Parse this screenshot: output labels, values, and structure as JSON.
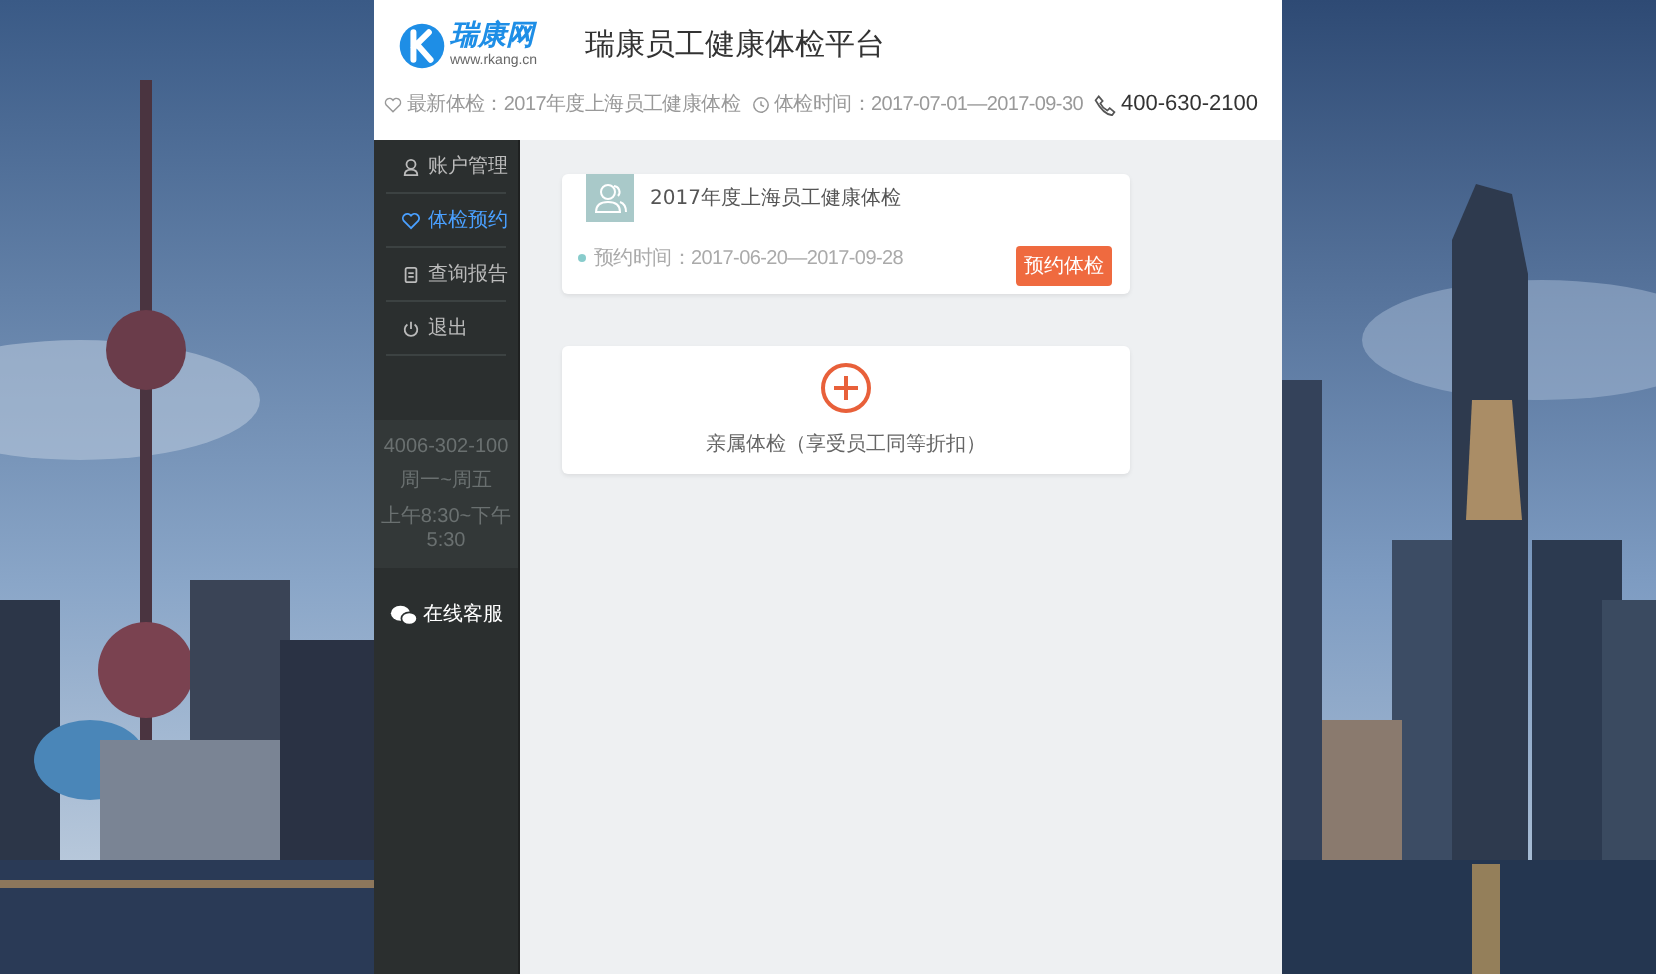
{
  "logo": {
    "name": "瑞康网",
    "url": "www.rkang.cn"
  },
  "title": "瑞康员工健康体检平台",
  "info": [
    {
      "kind": "heart",
      "text": "最新体检：2017年度上海员工健康体检"
    },
    {
      "kind": "clock",
      "text": "体检时间：2017-07-01—2017-09-30"
    }
  ],
  "phone": "400-630-2100",
  "nav": [
    {
      "kind": "user",
      "label": "账户管理",
      "selected": false
    },
    {
      "kind": "heart",
      "label": "体检预约",
      "selected": true
    },
    {
      "kind": "doc",
      "label": "查询报告",
      "selected": false
    },
    {
      "kind": "power",
      "label": "退出",
      "selected": false
    }
  ],
  "contact": {
    "phone": "4006-302-100",
    "days": "周一~周五",
    "hours": "上午8:30~下午5:30"
  },
  "chat": "在线客服",
  "exam": {
    "title": "2017年度上海员工健康体检",
    "time": "预约时间：2017-06-20—2017-09-28",
    "button": "预约体检"
  },
  "add": {
    "label": "亲属体检（享受员工同等折扣）"
  }
}
